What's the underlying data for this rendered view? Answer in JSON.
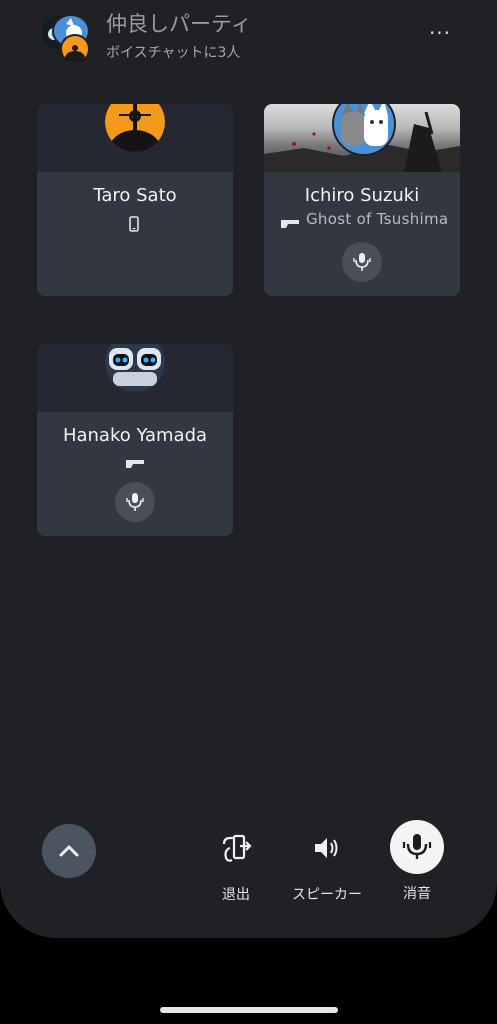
{
  "party": {
    "name": "仲良しパーティ",
    "subtitle": "ボイスチャットに3人"
  },
  "menu": {
    "more_icon": "more-horizontal-icon",
    "more_glyph": "···"
  },
  "members": [
    {
      "name": "Taro Sato",
      "platform_icon": "mobile-phone-icon"
    },
    {
      "name": "Ichiro Suzuki",
      "platform_icon": "ps5-console-icon",
      "game": "Ghost of Tsushima",
      "mic_icon": "microphone-icon"
    },
    {
      "name": "Hanako Yamada",
      "platform_icon": "ps5-console-icon",
      "mic_icon": "microphone-icon"
    }
  ],
  "controls": {
    "collapse_icon": "chevron-up-icon",
    "leave_label": "退出",
    "speaker_label": "スピーカー",
    "mute_label": "消音"
  },
  "colors": {
    "background": "#1f2125",
    "card": "#333740",
    "accent_orange": "#f39a1b"
  }
}
